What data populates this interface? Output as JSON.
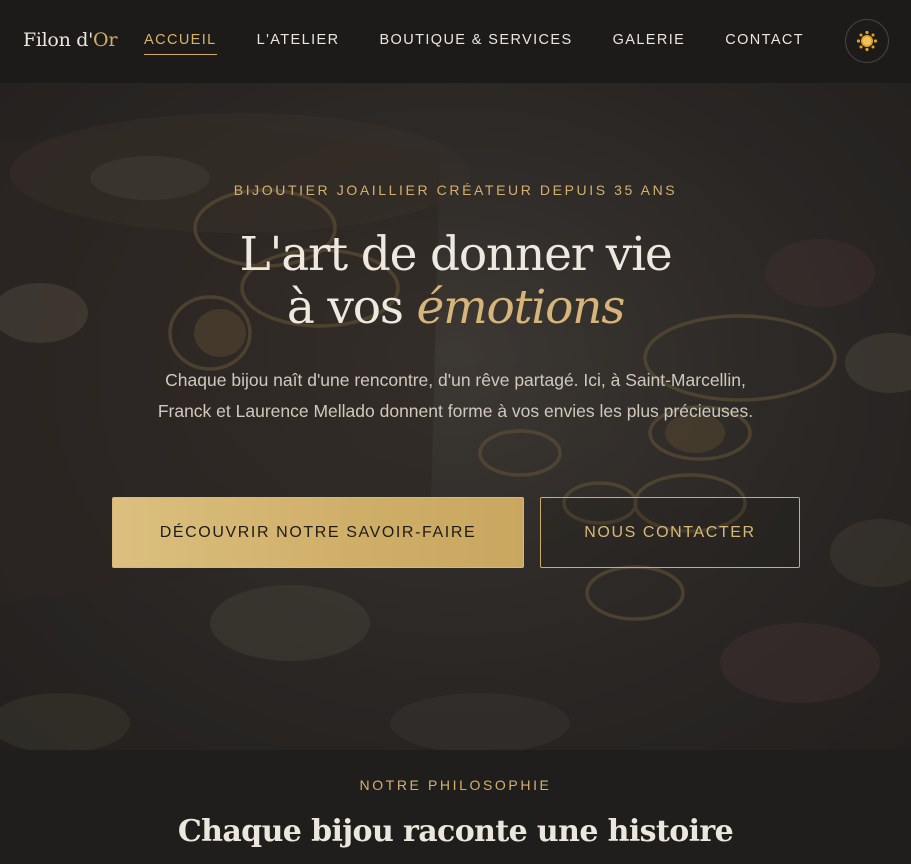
{
  "brand": {
    "name_part1": "Filon d'",
    "name_part2": "Or"
  },
  "nav": {
    "items": [
      {
        "label": "ACCUEIL",
        "active": true
      },
      {
        "label": "L'ATELIER",
        "active": false
      },
      {
        "label": "BOUTIQUE & SERVICES",
        "active": false
      },
      {
        "label": "GALERIE",
        "active": false
      },
      {
        "label": "CONTACT",
        "active": false
      }
    ],
    "theme_toggle_icon": "sun-icon"
  },
  "hero": {
    "eyebrow": "BIJOUTIER JOAILLIER CRÉATEUR DEPUIS 35 ANS",
    "title_line1": "L'art de donner vie",
    "title_line2_prefix": "à vos ",
    "title_line2_emphasis": "émotions",
    "description": "Chaque bijou naît d'une rencontre, d'un rêve partagé. Ici, à Saint-Marcellin, Franck et Laurence Mellado donnent forme à vos envies les plus précieuses.",
    "primary_button": "DÉCOUVRIR NOTRE SAVOIR-FAIRE",
    "secondary_button": "NOUS CONTACTER"
  },
  "philosophy": {
    "eyebrow": "NOTRE PHILOSOPHIE",
    "title": "Chaque bijou raconte une histoire"
  },
  "colors": {
    "accent_gold": "#d4b06c",
    "nav_background": "#1c1b1a",
    "page_background": "#1f1e1d"
  }
}
